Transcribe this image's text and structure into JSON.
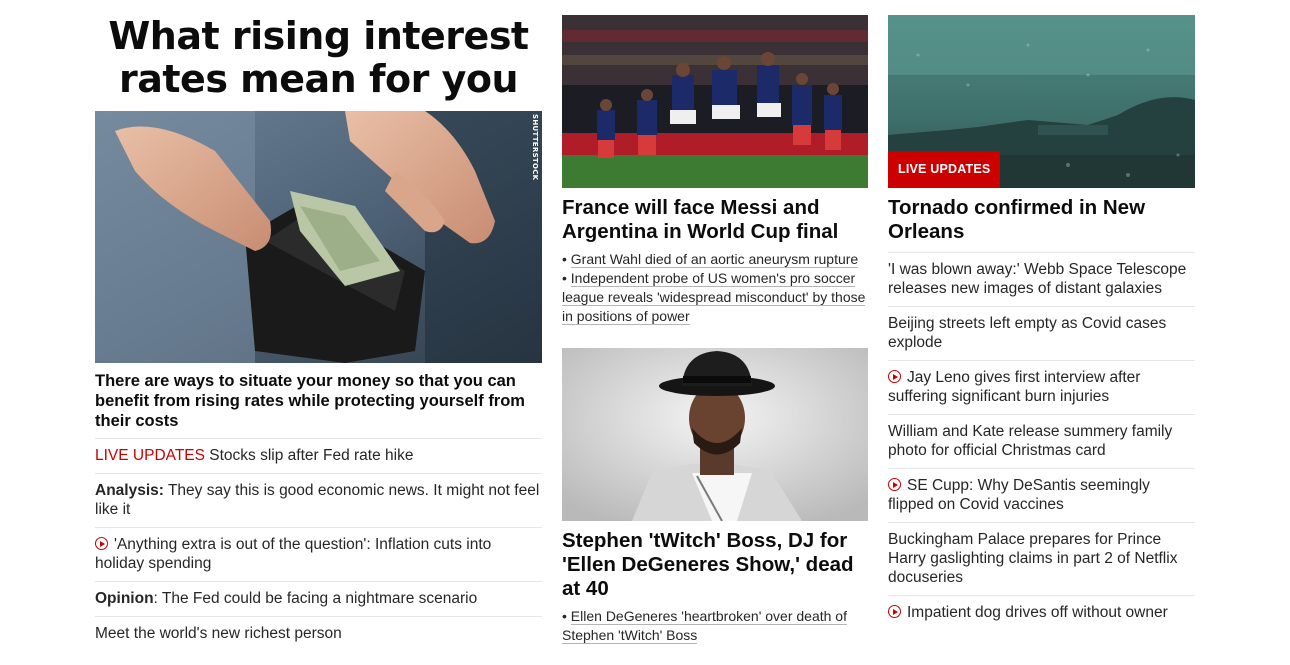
{
  "col1": {
    "hero_title": "What rising interest rates mean for you",
    "image_credit": "SHUTTERSTOCK",
    "lead_desc": "There are ways to situate your money so that you can benefit from rising rates while protecting yourself from their costs",
    "items": [
      {
        "prefix": "LIVE UPDATES",
        "text": " Stocks slip after Fed rate hike"
      },
      {
        "prefix": "Analysis:",
        "text": " They say this is good economic news. It might not feel like it"
      },
      {
        "text": "'Anything extra is out of the question': Inflation cuts into holiday spending"
      },
      {
        "prefix": "Opinion",
        "text": ": The Fed could be facing a nightmare scenario"
      },
      {
        "text": "Meet the world's new richest person"
      }
    ]
  },
  "col2": {
    "story1": {
      "headline": "France will face Messi and Argentina in World Cup final",
      "bullets": [
        "Grant Wahl died of an aortic aneurysm rupture",
        "Independent probe of US women's pro soccer league reveals 'widespread misconduct' by those in positions of power"
      ]
    },
    "story2": {
      "headline": "Stephen 'tWitch' Boss, DJ for 'Ellen DeGeneres Show,' dead at 40",
      "bullets": [
        "Ellen DeGeneres 'heartbroken' over death of Stephen 'tWitch' Boss"
      ]
    }
  },
  "col3": {
    "badge": "LIVE UPDATES",
    "headline": "Tornado confirmed in New Orleans",
    "items": [
      {
        "text": "'I was blown away:' Webb Space Telescope releases new images of distant galaxies"
      },
      {
        "text": "Beijing streets left empty as Covid cases explode"
      },
      {
        "text": "Jay Leno gives first interview after suffering significant burn injuries"
      },
      {
        "text": "William and Kate release summery family photo for official Christmas card"
      },
      {
        "text": "SE Cupp: Why DeSantis seemingly flipped on Covid vaccines"
      },
      {
        "text": "Buckingham Palace prepares for Prince Harry gaslighting claims in part 2 of Netflix docuseries"
      },
      {
        "text": "Impatient dog drives off without owner"
      }
    ]
  },
  "colors": {
    "accent_red": "#cc0000",
    "text": "#0c0c0c",
    "divider": "#e6e6e6"
  }
}
